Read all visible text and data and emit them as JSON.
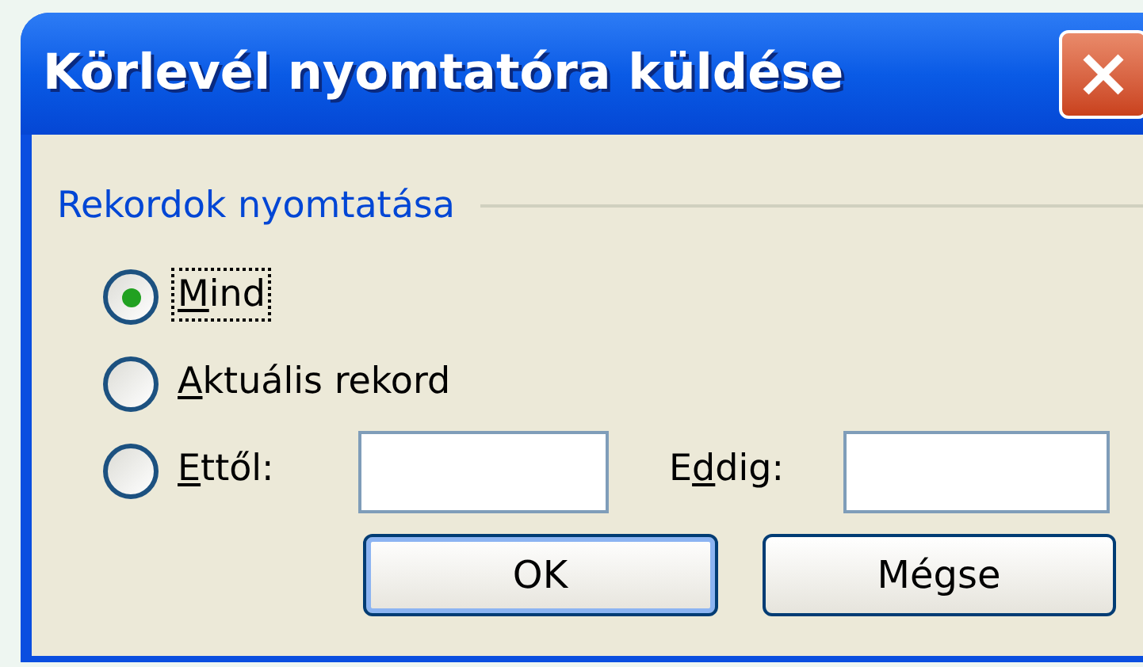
{
  "window": {
    "title": "Körlevél nyomtatóra küldése"
  },
  "group": {
    "title": "Rekordok nyomtatása"
  },
  "options": [
    {
      "kind": "plain",
      "label": {
        "key": "M",
        "after": "ind"
      },
      "selected": true,
      "focused": true
    },
    {
      "kind": "plain",
      "label": {
        "key": "A",
        "after": "ktuális rekord"
      },
      "selected": false,
      "focused": false
    },
    {
      "kind": "range",
      "label": {
        "key": "E",
        "after": "ttől:"
      },
      "selected": false,
      "focused": false,
      "to_label": {
        "before": "E",
        "key": "d",
        "after": "dig:"
      }
    }
  ],
  "buttons": [
    {
      "label": "OK",
      "default": true
    },
    {
      "label": "Mégse",
      "default": false
    }
  ]
}
